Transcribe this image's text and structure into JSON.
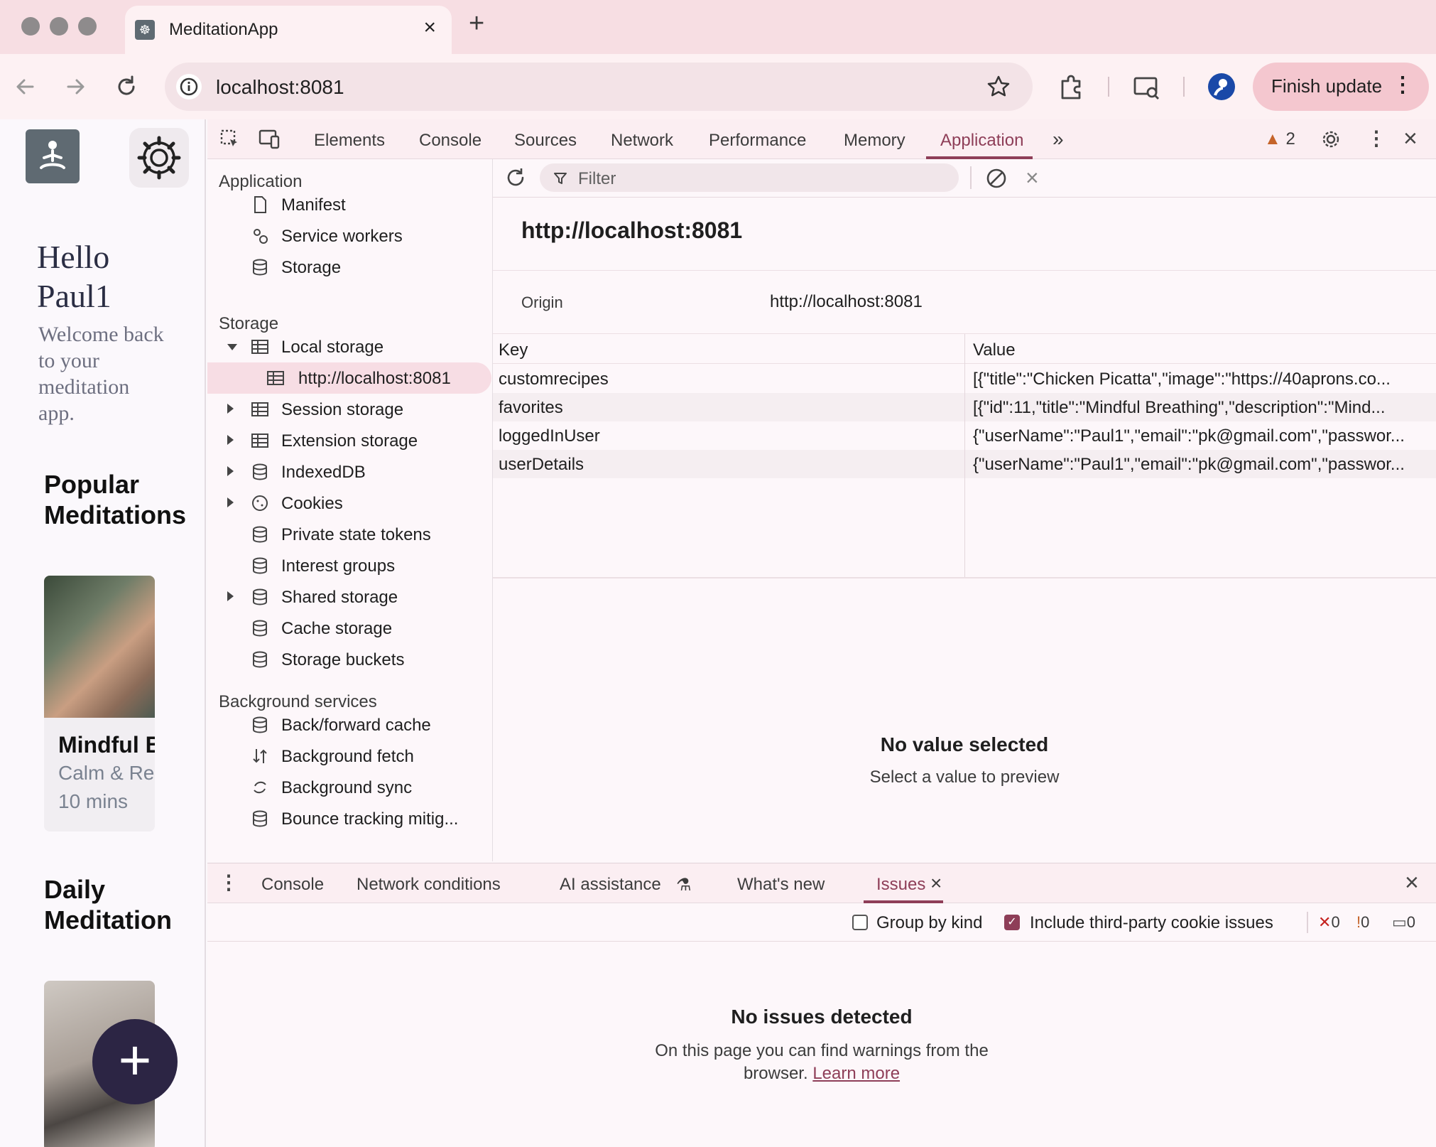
{
  "browser": {
    "tab_title": "MeditationApp",
    "url": "localhost:8081",
    "finish_update_label": "Finish update"
  },
  "app": {
    "greeting": "Hello Paul1",
    "welcome": "Welcome back to your meditation app.",
    "popular_title": "Popular Meditations",
    "card": {
      "name": "Mindful Breathing",
      "subtitle": "Calm & Relax",
      "duration": "10 mins"
    },
    "daily_title": "Daily Meditation"
  },
  "devtools": {
    "tabs": [
      "Elements",
      "Console",
      "Sources",
      "Network",
      "Performance",
      "Memory",
      "Application"
    ],
    "active_tab": "Application",
    "issues_count": "2",
    "sidebar": {
      "application_header": "Application",
      "application_items": [
        "Manifest",
        "Service workers",
        "Storage"
      ],
      "storage_header": "Storage",
      "local_storage": "Local storage",
      "local_origin": "http://localhost:8081",
      "storage_items": [
        "Session storage",
        "Extension storage",
        "IndexedDB",
        "Cookies",
        "Private state tokens",
        "Interest groups",
        "Shared storage",
        "Cache storage",
        "Storage buckets"
      ],
      "bg_header": "Background services",
      "bg_items": [
        "Back/forward cache",
        "Background fetch",
        "Background sync",
        "Bounce tracking mitig..."
      ]
    },
    "filter_placeholder": "Filter",
    "origin_title": "http://localhost:8081",
    "origin_label": "Origin",
    "origin_value": "http://localhost:8081",
    "table": {
      "key_header": "Key",
      "value_header": "Value",
      "rows": [
        {
          "key": "customrecipes",
          "value": "[{\"title\":\"Chicken Picatta\",\"image\":\"https://40aprons.co..."
        },
        {
          "key": "favorites",
          "value": "[{\"id\":11,\"title\":\"Mindful Breathing\",\"description\":\"Mind..."
        },
        {
          "key": "loggedInUser",
          "value": "{\"userName\":\"Paul1\",\"email\":\"pk@gmail.com\",\"passwor..."
        },
        {
          "key": "userDetails",
          "value": "{\"userName\":\"Paul1\",\"email\":\"pk@gmail.com\",\"passwor..."
        }
      ]
    },
    "preview_title": "No value selected",
    "preview_sub": "Select a value to preview"
  },
  "drawer": {
    "tabs": [
      "Console",
      "Network conditions",
      "AI assistance",
      "What's new",
      "Issues"
    ],
    "group_by_kind": "Group by kind",
    "include_third_party": "Include third-party cookie issues",
    "error_count": "0",
    "warning_count": "0",
    "info_count": "0",
    "no_issues_title": "No issues detected",
    "no_issues_text": "On this page you can find warnings from the browser.",
    "learn_more": "Learn more"
  }
}
